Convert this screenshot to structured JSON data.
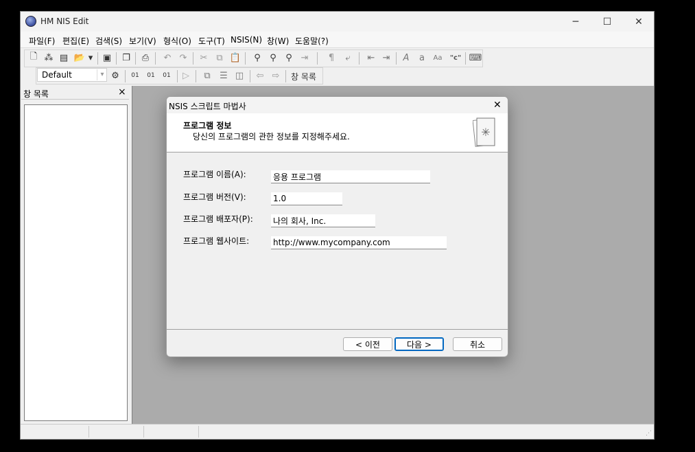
{
  "window": {
    "title": "HM NIS Edit",
    "controls": {
      "minimize": "─",
      "maximize": "☐",
      "close": "✕"
    }
  },
  "menubar": {
    "items": [
      "파일(F)",
      "편집(E)",
      "검색(S)",
      "보기(V)",
      "형식(O)",
      "도구(T)",
      "NSIS(N)",
      "창(W)",
      "도움말(?)"
    ]
  },
  "toolbar2": {
    "config_select": "Default",
    "window_list_label": "창 목록"
  },
  "side_panel": {
    "title": "창 목록",
    "close": "×"
  },
  "dialog": {
    "title": "NSIS 스크립트 마법사",
    "close": "✕",
    "header_title": "프로그램 정보",
    "header_subtitle": "당신의 프로그램의 관한 정보를 지정해주세요.",
    "fields": [
      {
        "label": "프로그램 이름(A):",
        "value": "응용 프로그램"
      },
      {
        "label": "프로그램 버전(V):",
        "value": "1.0"
      },
      {
        "label": "프로그램 배포자(P):",
        "value": "나의 회사, Inc."
      },
      {
        "label": "프로그램 웹사이트:",
        "value": "http://www.mycompany.com"
      }
    ],
    "buttons": {
      "back": "< 이전",
      "next": "다음 >",
      "cancel": "취소"
    }
  }
}
